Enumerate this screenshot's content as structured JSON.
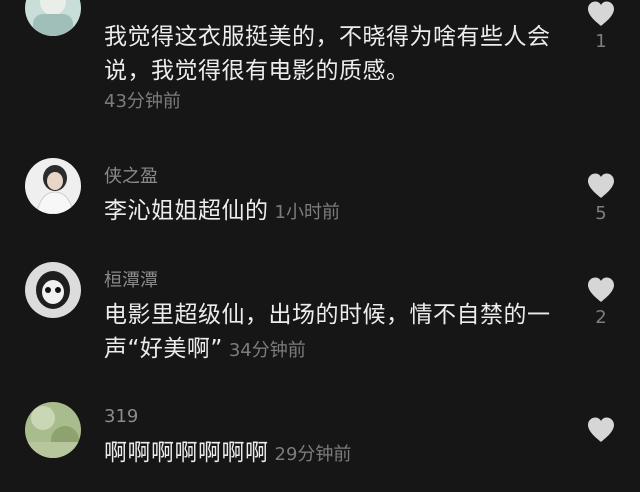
{
  "comments": [
    {
      "username": "",
      "text": "我觉得这衣服挺美的，不晓得为啥有些人会说，我觉得很有电影的质感。",
      "time": "43分钟前",
      "likes": "1"
    },
    {
      "username": "侠之盈",
      "text": "李沁姐姐超仙的",
      "time": "1小时前",
      "likes": "5"
    },
    {
      "username": "桓潭潭",
      "text": "电影里超级仙，出场的时候，情不自禁的一声“好美啊”",
      "time": "34分钟前",
      "likes": "2"
    },
    {
      "username": "319",
      "text": "啊啊啊啊啊啊啊",
      "time": "29分钟前",
      "likes": ""
    }
  ],
  "icons": {
    "like": "heart-icon"
  },
  "colors": {
    "background": "#161616",
    "text": "#ececec",
    "secondary": "#7c7c7c",
    "heart": "#d6d6d6"
  }
}
